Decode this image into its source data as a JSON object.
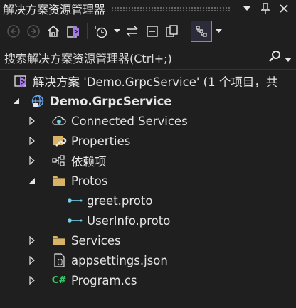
{
  "window": {
    "title": "解决方案资源管理器"
  },
  "search": {
    "placeholder": "搜索解决方案资源管理器(Ctrl+;)"
  },
  "solution": {
    "label": "解决方案 'Demo.GrpcService' (1 个项目，共"
  },
  "project": {
    "label": "Demo.GrpcService"
  },
  "items": [
    {
      "label": "Connected Services",
      "icon": "connected-services-icon"
    },
    {
      "label": "Properties",
      "icon": "wrench-icon"
    },
    {
      "label": "依赖项",
      "icon": "dependencies-icon"
    },
    {
      "label": "Protos",
      "icon": "folder-icon"
    },
    {
      "label": "greet.proto",
      "icon": "proto-file-icon"
    },
    {
      "label": "UserInfo.proto",
      "icon": "proto-file-icon"
    },
    {
      "label": "Services",
      "icon": "folder-icon"
    },
    {
      "label": "appsettings.json",
      "icon": "json-file-icon"
    },
    {
      "label": "Program.cs",
      "icon": "csharp-file-icon",
      "badge": "C#"
    }
  ],
  "colors": {
    "background": "#1f1f1f",
    "accent": "#8a7cf0",
    "csharp": "#38c86a",
    "folder": "#d9b365",
    "proto": "#6fd0e8"
  }
}
